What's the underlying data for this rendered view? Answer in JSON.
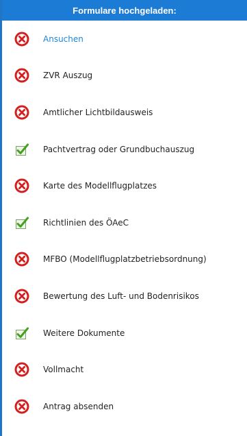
{
  "header": {
    "title": "Formulare hochgeladen:"
  },
  "colors": {
    "header_bg": "#1c7cd5",
    "left_border": "#1f75c6",
    "error_red": "#d51f1f",
    "check_green": "#45a01f",
    "link_blue": "#1f86d6"
  },
  "items": [
    {
      "label": "Ansuchen",
      "status": "missing",
      "icon": "error-icon"
    },
    {
      "label": "ZVR Auszug",
      "status": "missing",
      "icon": "error-icon"
    },
    {
      "label": "Amtlicher Lichtbildausweis",
      "status": "missing",
      "icon": "error-icon"
    },
    {
      "label": "Pachtvertrag oder Grundbuchauszug",
      "status": "uploaded",
      "icon": "checkbox-checked-icon"
    },
    {
      "label": "Karte des Modellflugplatzes",
      "status": "missing",
      "icon": "error-icon"
    },
    {
      "label": "Richtlinien des ÖAeC",
      "status": "uploaded",
      "icon": "checkbox-checked-icon"
    },
    {
      "label": "MFBO (Modellflugplatzbetriebsordnung)",
      "status": "missing",
      "icon": "error-icon"
    },
    {
      "label": "Bewertung des Luft- und Bodenrisikos",
      "status": "missing",
      "icon": "error-icon"
    },
    {
      "label": "Weitere Dokumente",
      "status": "uploaded",
      "icon": "checkbox-checked-icon"
    },
    {
      "label": "Vollmacht",
      "status": "missing",
      "icon": "error-icon"
    },
    {
      "label": "Antrag absenden",
      "status": "missing",
      "icon": "error-icon"
    }
  ]
}
